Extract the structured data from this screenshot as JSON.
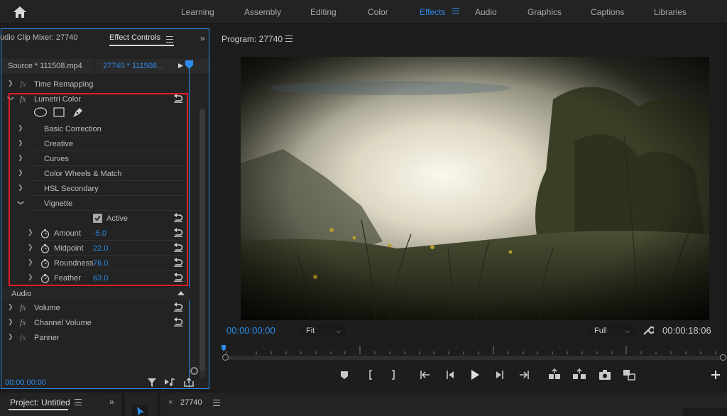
{
  "workspaces": {
    "items": [
      "Learning",
      "Assembly",
      "Editing",
      "Color",
      "Effects",
      "Audio",
      "Graphics",
      "Captions",
      "Libraries"
    ],
    "active": "Effects"
  },
  "left_panel": {
    "tabs": {
      "audio_clip_mixer": "udio Clip Mixer: 27740",
      "effect_controls": "Effect Controls"
    },
    "source_label": "Source * 111508.mp4",
    "sequence_label": "27740 * 111508...",
    "time_remapping": "Time Remapping",
    "lumetri": {
      "title": "Lumetri Color",
      "sections": [
        "Basic Correction",
        "Creative",
        "Curves",
        "Color Wheels & Match",
        "HSL Secondary",
        "Vignette"
      ],
      "active_label": "Active",
      "active_checked": true,
      "params": [
        {
          "label": "Amount",
          "value": "-5.0"
        },
        {
          "label": "Midpoint",
          "value": "22.0"
        },
        {
          "label": "Roundness",
          "value": "76.0"
        },
        {
          "label": "Feather",
          "value": "63.0"
        }
      ]
    },
    "audio": {
      "header": "Audio",
      "effects": [
        "Volume",
        "Channel Volume",
        "Panner"
      ]
    },
    "timecode": "00:00:00:00"
  },
  "program": {
    "title": "Program: 27740",
    "current_timecode": "00:00:00:00",
    "fit_label": "Fit",
    "quality_label": "Full",
    "duration_timecode": "00:00:18:06"
  },
  "bottom": {
    "project_title": "Project: Untitled",
    "timeline_title": "27740"
  },
  "colors": {
    "accent": "#2d8ceb",
    "highlight": "#e01e24",
    "panel": "#232323"
  }
}
